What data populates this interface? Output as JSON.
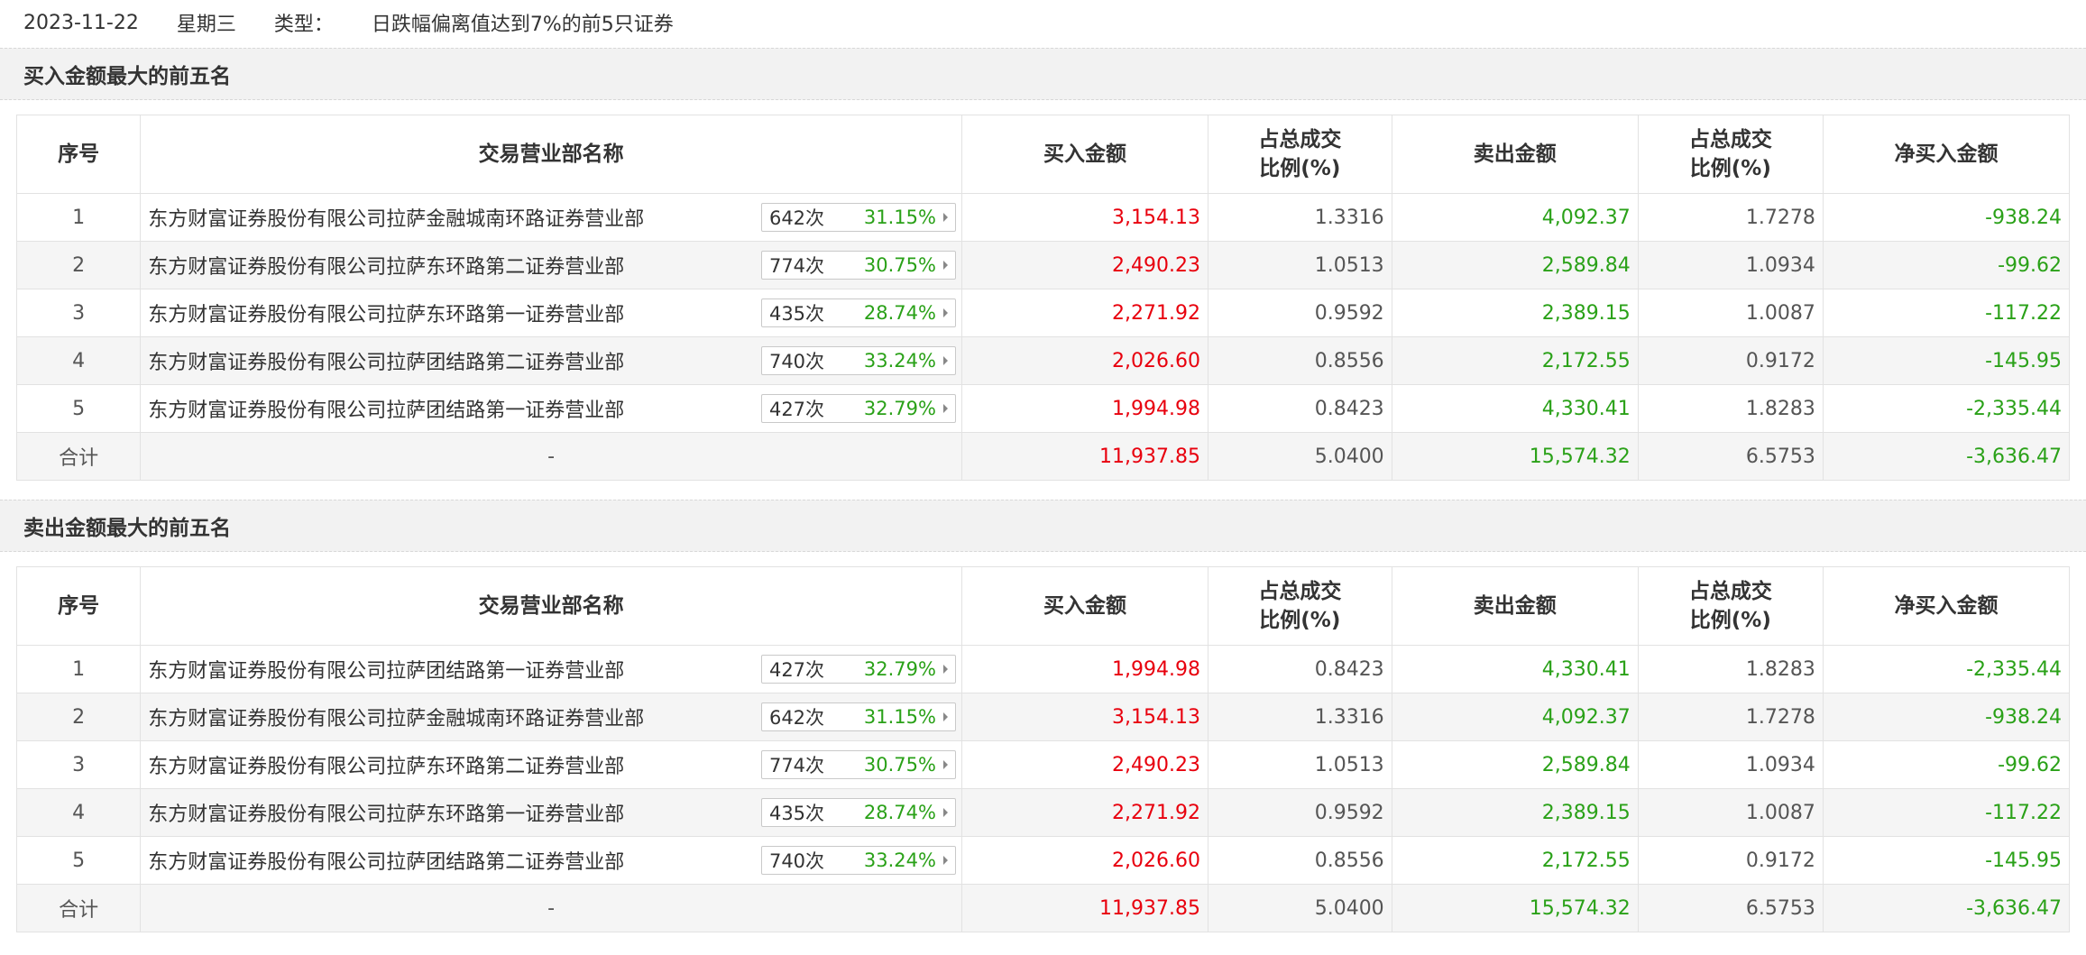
{
  "info": {
    "date": "2023-11-22",
    "weekday": "星期三",
    "type_label": "类型：",
    "type_value": "日跌幅偏离值达到7%的前5只证券"
  },
  "columns": {
    "idx": "序号",
    "dept": "交易营业部名称",
    "buy": "买入金额",
    "buy_ratio": "占总成交比例(%)",
    "sell": "卖出金额",
    "sell_ratio": "占总成交比例(%)",
    "net": "净买入金额"
  },
  "buy_section": {
    "title": "买入金额最大的前五名",
    "rows": [
      {
        "idx": "1",
        "dept": "东方财富证券股份有限公司拉萨金融城南环路证券营业部",
        "count": "642次",
        "pct": "31.15%",
        "buy": "3,154.13",
        "buy_ratio": "1.3316",
        "sell": "4,092.37",
        "sell_ratio": "1.7278",
        "net": "-938.24"
      },
      {
        "idx": "2",
        "dept": "东方财富证券股份有限公司拉萨东环路第二证券营业部",
        "count": "774次",
        "pct": "30.75%",
        "buy": "2,490.23",
        "buy_ratio": "1.0513",
        "sell": "2,589.84",
        "sell_ratio": "1.0934",
        "net": "-99.62"
      },
      {
        "idx": "3",
        "dept": "东方财富证券股份有限公司拉萨东环路第一证券营业部",
        "count": "435次",
        "pct": "28.74%",
        "buy": "2,271.92",
        "buy_ratio": "0.9592",
        "sell": "2,389.15",
        "sell_ratio": "1.0087",
        "net": "-117.22"
      },
      {
        "idx": "4",
        "dept": "东方财富证券股份有限公司拉萨团结路第二证券营业部",
        "count": "740次",
        "pct": "33.24%",
        "buy": "2,026.60",
        "buy_ratio": "0.8556",
        "sell": "2,172.55",
        "sell_ratio": "0.9172",
        "net": "-145.95"
      },
      {
        "idx": "5",
        "dept": "东方财富证券股份有限公司拉萨团结路第一证券营业部",
        "count": "427次",
        "pct": "32.79%",
        "buy": "1,994.98",
        "buy_ratio": "0.8423",
        "sell": "4,330.41",
        "sell_ratio": "1.8283",
        "net": "-2,335.44"
      }
    ],
    "total": {
      "label": "合计",
      "dept": "-",
      "buy": "11,937.85",
      "buy_ratio": "5.0400",
      "sell": "15,574.32",
      "sell_ratio": "6.5753",
      "net": "-3,636.47"
    }
  },
  "sell_section": {
    "title": "卖出金额最大的前五名",
    "rows": [
      {
        "idx": "1",
        "dept": "东方财富证券股份有限公司拉萨团结路第一证券营业部",
        "count": "427次",
        "pct": "32.79%",
        "buy": "1,994.98",
        "buy_ratio": "0.8423",
        "sell": "4,330.41",
        "sell_ratio": "1.8283",
        "net": "-2,335.44"
      },
      {
        "idx": "2",
        "dept": "东方财富证券股份有限公司拉萨金融城南环路证券营业部",
        "count": "642次",
        "pct": "31.15%",
        "buy": "3,154.13",
        "buy_ratio": "1.3316",
        "sell": "4,092.37",
        "sell_ratio": "1.7278",
        "net": "-938.24"
      },
      {
        "idx": "3",
        "dept": "东方财富证券股份有限公司拉萨东环路第二证券营业部",
        "count": "774次",
        "pct": "30.75%",
        "buy": "2,490.23",
        "buy_ratio": "1.0513",
        "sell": "2,589.84",
        "sell_ratio": "1.0934",
        "net": "-99.62"
      },
      {
        "idx": "4",
        "dept": "东方财富证券股份有限公司拉萨东环路第一证券营业部",
        "count": "435次",
        "pct": "28.74%",
        "buy": "2,271.92",
        "buy_ratio": "0.9592",
        "sell": "2,389.15",
        "sell_ratio": "1.0087",
        "net": "-117.22"
      },
      {
        "idx": "5",
        "dept": "东方财富证券股份有限公司拉萨团结路第二证券营业部",
        "count": "740次",
        "pct": "33.24%",
        "buy": "2,026.60",
        "buy_ratio": "0.8556",
        "sell": "2,172.55",
        "sell_ratio": "0.9172",
        "net": "-145.95"
      }
    ],
    "total": {
      "label": "合计",
      "dept": "-",
      "buy": "11,937.85",
      "buy_ratio": "5.0400",
      "sell": "15,574.32",
      "sell_ratio": "6.5753",
      "net": "-3,636.47"
    }
  },
  "colors": {
    "buy": "#e8000d",
    "sell": "#2aa118",
    "net_negative": "#2aa118",
    "header_bg": "#f2f2f2",
    "alt_row_bg": "#f5f5f5"
  },
  "icons": {
    "badge_arrow": "caret-right-icon"
  }
}
